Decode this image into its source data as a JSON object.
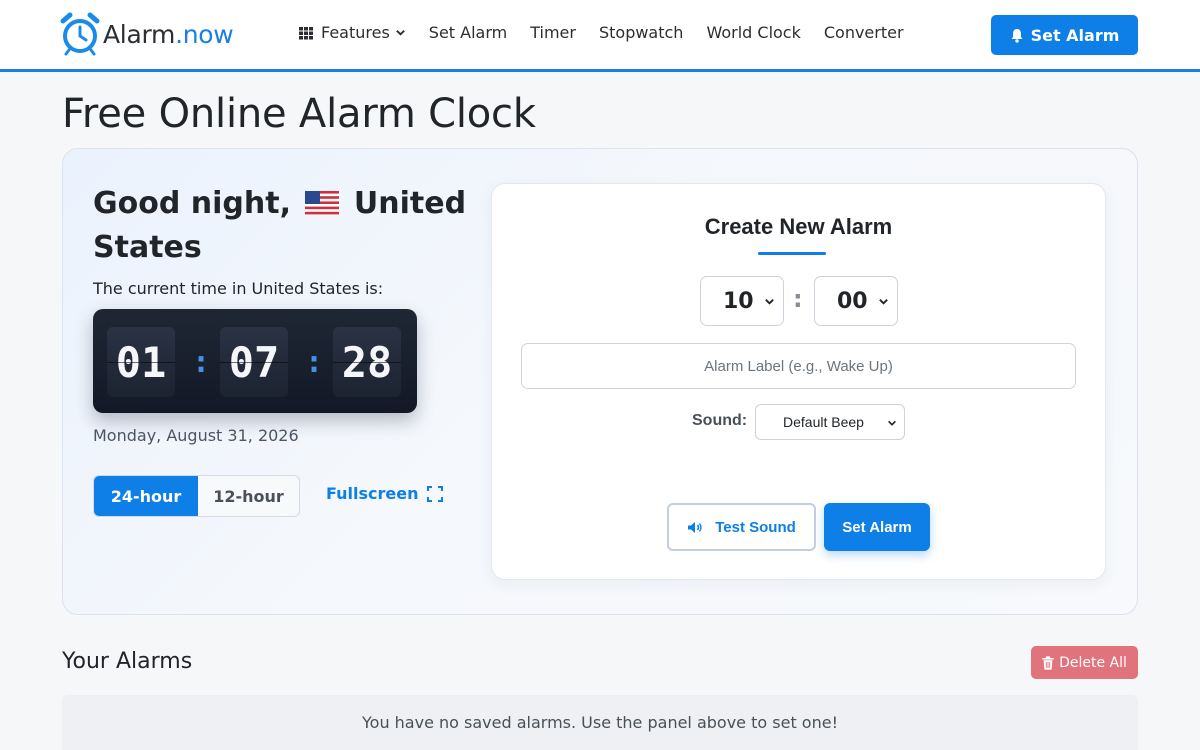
{
  "brand": {
    "name": "Alarm",
    "suffix": ".now"
  },
  "nav": {
    "features_label": "Features",
    "links": [
      "Set Alarm",
      "Timer",
      "Stopwatch",
      "World Clock",
      "Converter"
    ],
    "cta_label": "Set Alarm"
  },
  "page_title": "Free Online Alarm Clock",
  "greeting": {
    "text": "Good night,",
    "country": "United States"
  },
  "clock": {
    "label": "The current time in United States is:",
    "hours": "01",
    "minutes": "07",
    "seconds": "28",
    "date": "Monday, August 31, 2026"
  },
  "format": {
    "active": "24-hour",
    "inactive": "12-hour",
    "fullscreen": "Fullscreen"
  },
  "create": {
    "title": "Create New Alarm",
    "hour": "10",
    "minute": "00",
    "label_placeholder": "Alarm Label (e.g., Wake Up)",
    "sound_label": "Sound:",
    "sound_value": "Default Beep",
    "test_label": "Test Sound",
    "set_label": "Set Alarm"
  },
  "alarms": {
    "title": "Your Alarms",
    "delete_all": "Delete All",
    "empty": "You have no saved alarms. Use the panel above to set one!"
  },
  "colors": {
    "accent": "#0d7fe6",
    "danger": "#e0737c",
    "clock_bg": "#121826"
  }
}
